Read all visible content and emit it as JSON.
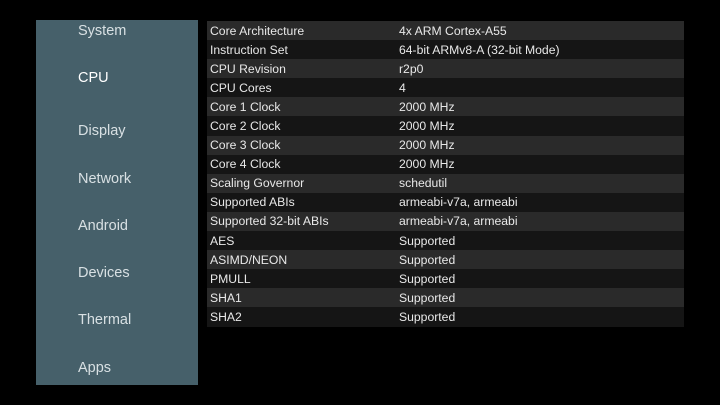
{
  "sidebar": {
    "items": [
      {
        "label": "System"
      },
      {
        "label": "CPU",
        "selected": true
      },
      {
        "label": "Display"
      },
      {
        "label": "Network"
      },
      {
        "label": "Android"
      },
      {
        "label": "Devices"
      },
      {
        "label": "Thermal"
      },
      {
        "label": "Apps"
      }
    ]
  },
  "cpu_info": {
    "rows": [
      {
        "key": "Core Architecture",
        "value": "4x ARM Cortex-A55"
      },
      {
        "key": "Instruction Set",
        "value": "64-bit ARMv8-A (32-bit Mode)"
      },
      {
        "key": "CPU Revision",
        "value": "r2p0"
      },
      {
        "key": "CPU Cores",
        "value": "4"
      },
      {
        "key": "Core 1 Clock",
        "value": "2000 MHz"
      },
      {
        "key": "Core 2 Clock",
        "value": "2000 MHz"
      },
      {
        "key": "Core 3 Clock",
        "value": "2000 MHz"
      },
      {
        "key": "Core 4 Clock",
        "value": "2000 MHz"
      },
      {
        "key": "Scaling Governor",
        "value": "schedutil"
      },
      {
        "key": "Supported ABIs",
        "value": "armeabi-v7a, armeabi"
      },
      {
        "key": "Supported 32-bit ABIs",
        "value": "armeabi-v7a, armeabi"
      },
      {
        "key": "AES",
        "value": "Supported"
      },
      {
        "key": "ASIMD/NEON",
        "value": "Supported"
      },
      {
        "key": "PMULL",
        "value": "Supported"
      },
      {
        "key": "SHA1",
        "value": "Supported"
      },
      {
        "key": "SHA2",
        "value": "Supported"
      }
    ]
  },
  "colors": {
    "sidebar_bg": "#46606a",
    "row_light": "#2a2a2a",
    "row_dark": "#151515",
    "text": "#e8e8e8"
  }
}
